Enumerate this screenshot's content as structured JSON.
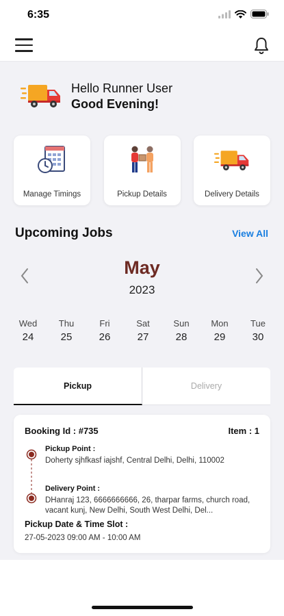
{
  "status_bar": {
    "time": "6:35"
  },
  "greeting": {
    "hello": "Hello Runner User",
    "salutation": "Good Evening!"
  },
  "quick_actions": [
    {
      "label": "Manage Timings",
      "icon": "schedule-icon"
    },
    {
      "label": "Pickup Details",
      "icon": "handover-icon"
    },
    {
      "label": "Delivery Details",
      "icon": "delivery-truck-icon"
    }
  ],
  "upcoming": {
    "title": "Upcoming Jobs",
    "view_all": "View All"
  },
  "calendar": {
    "month": "May",
    "year": "2023",
    "days": [
      {
        "name": "Wed",
        "date": "24"
      },
      {
        "name": "Thu",
        "date": "25"
      },
      {
        "name": "Fri",
        "date": "26"
      },
      {
        "name": "Sat",
        "date": "27"
      },
      {
        "name": "Sun",
        "date": "28"
      },
      {
        "name": "Mon",
        "date": "29"
      },
      {
        "name": "Tue",
        "date": "30"
      }
    ]
  },
  "tabs": {
    "pickup": "Pickup",
    "delivery": "Delivery",
    "active": "Pickup"
  },
  "job": {
    "booking_id": "Booking Id : #735",
    "item": "Item : 1",
    "pickup_label": "Pickup Point :",
    "pickup_address": "Doherty sjhfkasf iajshf, Central Delhi, Delhi, 110002",
    "delivery_label": "Delivery Point :",
    "delivery_address": "DHanraj 123, 6666666666, 26, tharpar farms, church road, vacant kunj, New Delhi, South West Delhi, Del...",
    "slot_label": "Pickup Date & Time Slot :",
    "slot_value": "27-05-2023 09:00 AM - 10:00 AM"
  },
  "colors": {
    "accent": "#1a7fe0",
    "month": "#6d2a23",
    "background": "#f2f2f6",
    "timeline_dot": "#8b2a20",
    "truck_orange": "#f5a623",
    "truck_red": "#e53935"
  }
}
